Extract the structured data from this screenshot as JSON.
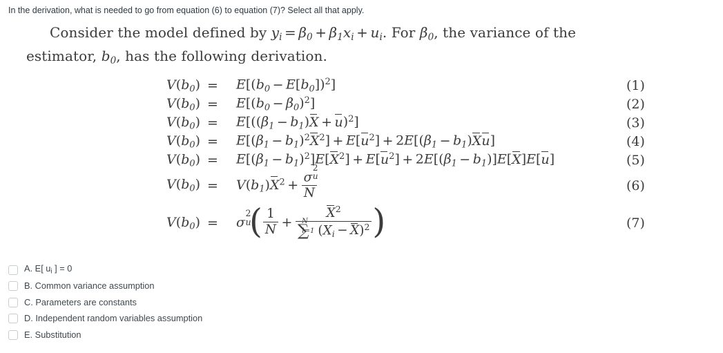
{
  "question": {
    "prompt": "In the derivation, what is needed to go from equation (6) to equation (7)? Select all that apply."
  },
  "passage": {
    "intro_before_formula": "Consider the model defined by ",
    "formula_inline": "y_i = β0 + β1 x_i + u_i",
    "intro_after_formula": ". For β0, the variance of the estimator, b0, has the following derivation."
  },
  "derivation": {
    "lhs": "V(b0)",
    "relation": "=",
    "equations": [
      {
        "number": "(1)",
        "lhs": "V(b₀)",
        "rhs": "E[(b₀ − E[b₀])²]"
      },
      {
        "number": "(2)",
        "lhs": "V(b₀)",
        "rhs": "E[(b₀ − β₀)²]"
      },
      {
        "number": "(3)",
        "lhs": "V(b₀)",
        "rhs": "E[((β₁ − b₁)X̄ + ū)²]"
      },
      {
        "number": "(4)",
        "lhs": "V(b₀)",
        "rhs": "E[(β₁ − b₁)²X̄²] + E[ū²] + 2E[(β₁ − b₁)X̄ū]"
      },
      {
        "number": "(5)",
        "lhs": "V(b₀)",
        "rhs": "E[(β₁ − b₁)²]E[X̄²] + E[ū²] + 2E[(β₁ − b₁)]E[X̄]E[ū]"
      },
      {
        "number": "(6)",
        "lhs": "V(b₀)",
        "rhs": "V(b₁)X̄² + σ²ᵤ/N"
      },
      {
        "number": "(7)",
        "lhs": "V(b₀)",
        "rhs": "σ²ᵤ ( 1/N + X̄² / Σᵢ₌₁ᴺ (Xᵢ − X̄)² )"
      }
    ],
    "symbols": {
      "V": "V",
      "E": "E",
      "b": "b",
      "beta": "β",
      "sigma": "σ",
      "N": "N",
      "X": "X",
      "u": "u",
      "i": "i",
      "zero": "0",
      "one": "1",
      "two": "2",
      "plus": "+",
      "minus": "−",
      "equals": "=",
      "sum": "∑",
      "lparen": "(",
      "rparen": ")",
      "lbrack": "[",
      "rbrack": "]",
      "lbigparen": "(",
      "rbigparen": ")",
      "i_eq_1": "i=1"
    }
  },
  "options": [
    {
      "id": "A",
      "label_prefix": "A.",
      "text": "E[ u",
      "subscript": "i",
      "text_tail": " ] = 0"
    },
    {
      "id": "B",
      "label_prefix": "B.",
      "text": "Common variance assumption",
      "subscript": "",
      "text_tail": ""
    },
    {
      "id": "C",
      "label_prefix": "C.",
      "text": "Parameters are constants",
      "subscript": "",
      "text_tail": ""
    },
    {
      "id": "D",
      "label_prefix": "D.",
      "text": "Independent random variables assumption",
      "subscript": "",
      "text_tail": ""
    },
    {
      "id": "E",
      "label_prefix": "E.",
      "text": "Substitution",
      "subscript": "",
      "text_tail": ""
    }
  ],
  "colors": {
    "background": "#ffffff",
    "prompt_text": "#2f3941",
    "math_text": "#3c3c3c",
    "option_text": "#3f484f",
    "checkbox_border": "#c8cdd2"
  }
}
